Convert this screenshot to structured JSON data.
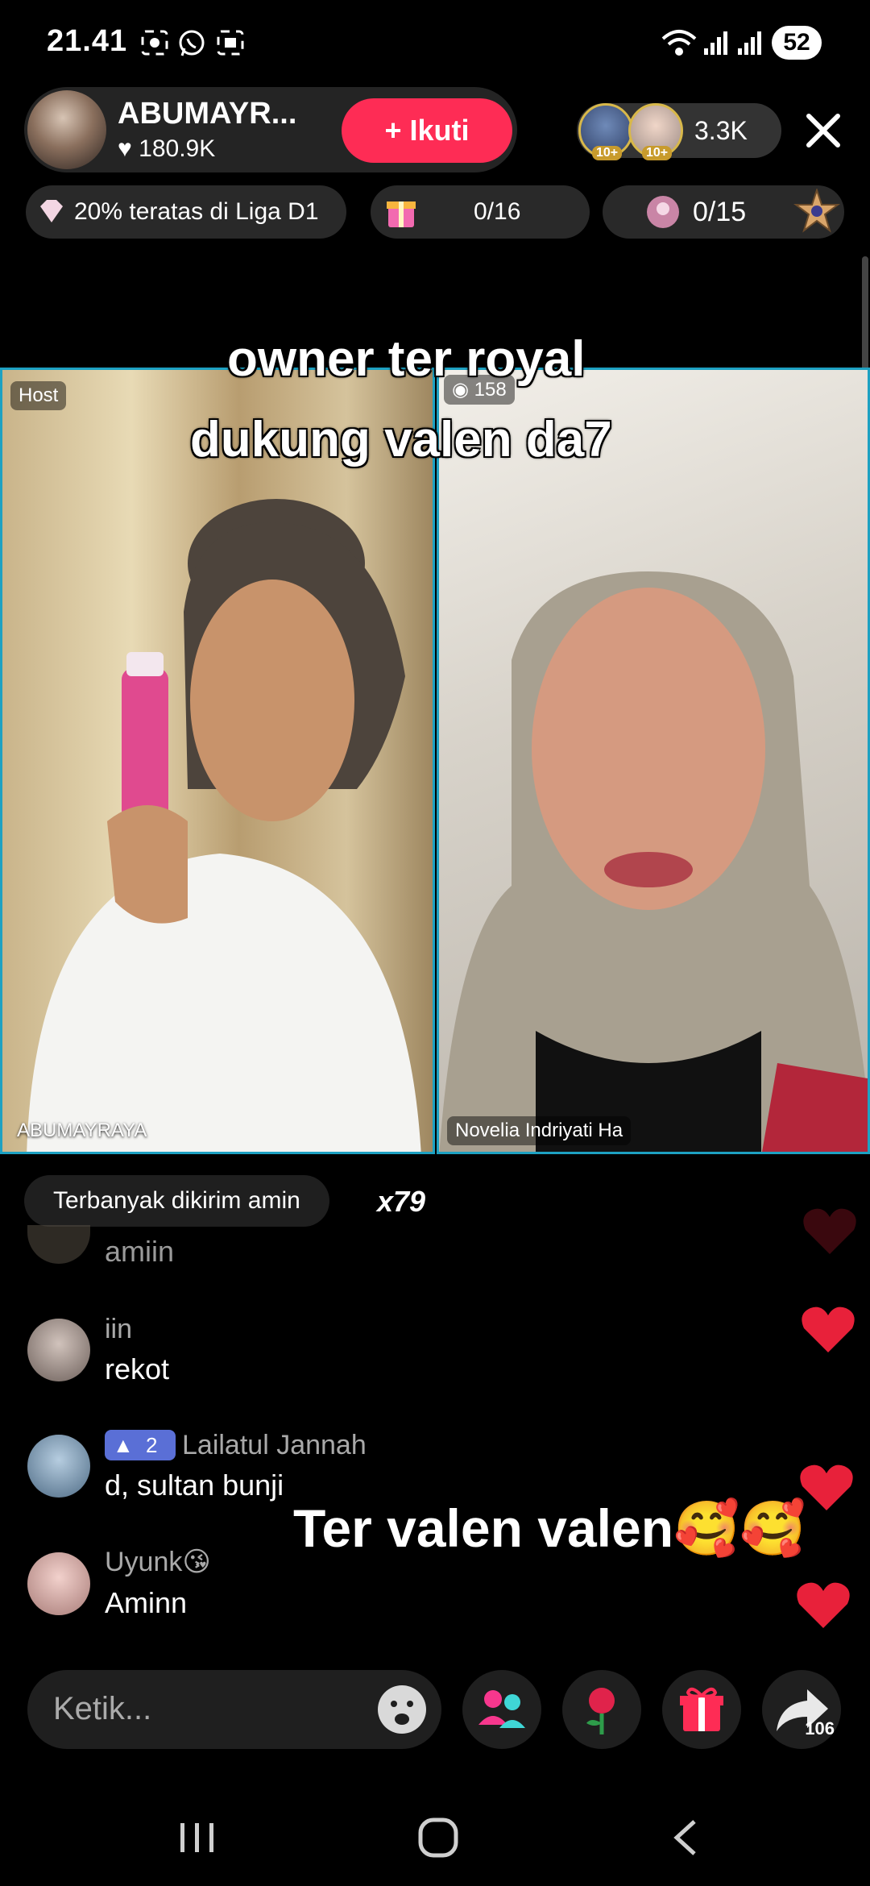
{
  "status_bar": {
    "time": "21.41",
    "battery": "52"
  },
  "host": {
    "name": "ABUMAYR...",
    "likes": "180.9K",
    "follow_label": "+ Ikuti",
    "viewer_count": "3.3K",
    "viewer_badges": [
      "10+",
      "10+"
    ]
  },
  "pills": {
    "league": "20% teratas di Liga D1",
    "gift_progress": "0/16",
    "goal_progress": "0/15"
  },
  "overlay": {
    "line1": "owner ter royal",
    "line2": "dukung valen da7",
    "bottom": "Ter valen valen🥰🥰"
  },
  "battle": {
    "host_tag": "Host",
    "score": "158",
    "left_name": "ABUMAYRAYA",
    "right_name": "Novelia Indriyati Ha"
  },
  "comments_header": {
    "label": "Terbanyak dikirim",
    "word": "amin",
    "multiplier": "x79"
  },
  "comments": [
    {
      "user": "",
      "text": "amiin"
    },
    {
      "user": "iin",
      "text": "rekot"
    },
    {
      "user": "Lailatul Jannah",
      "level": "2",
      "text": "d, sultan bunji"
    },
    {
      "user": "Uyunk😘",
      "text": "Aminn"
    }
  ],
  "bottom_bar": {
    "placeholder": "Ketik...",
    "share_count": "106"
  },
  "colors": {
    "accent": "#fe2c55",
    "panel_border": "#1da1c2",
    "heart": "#e8213a"
  }
}
